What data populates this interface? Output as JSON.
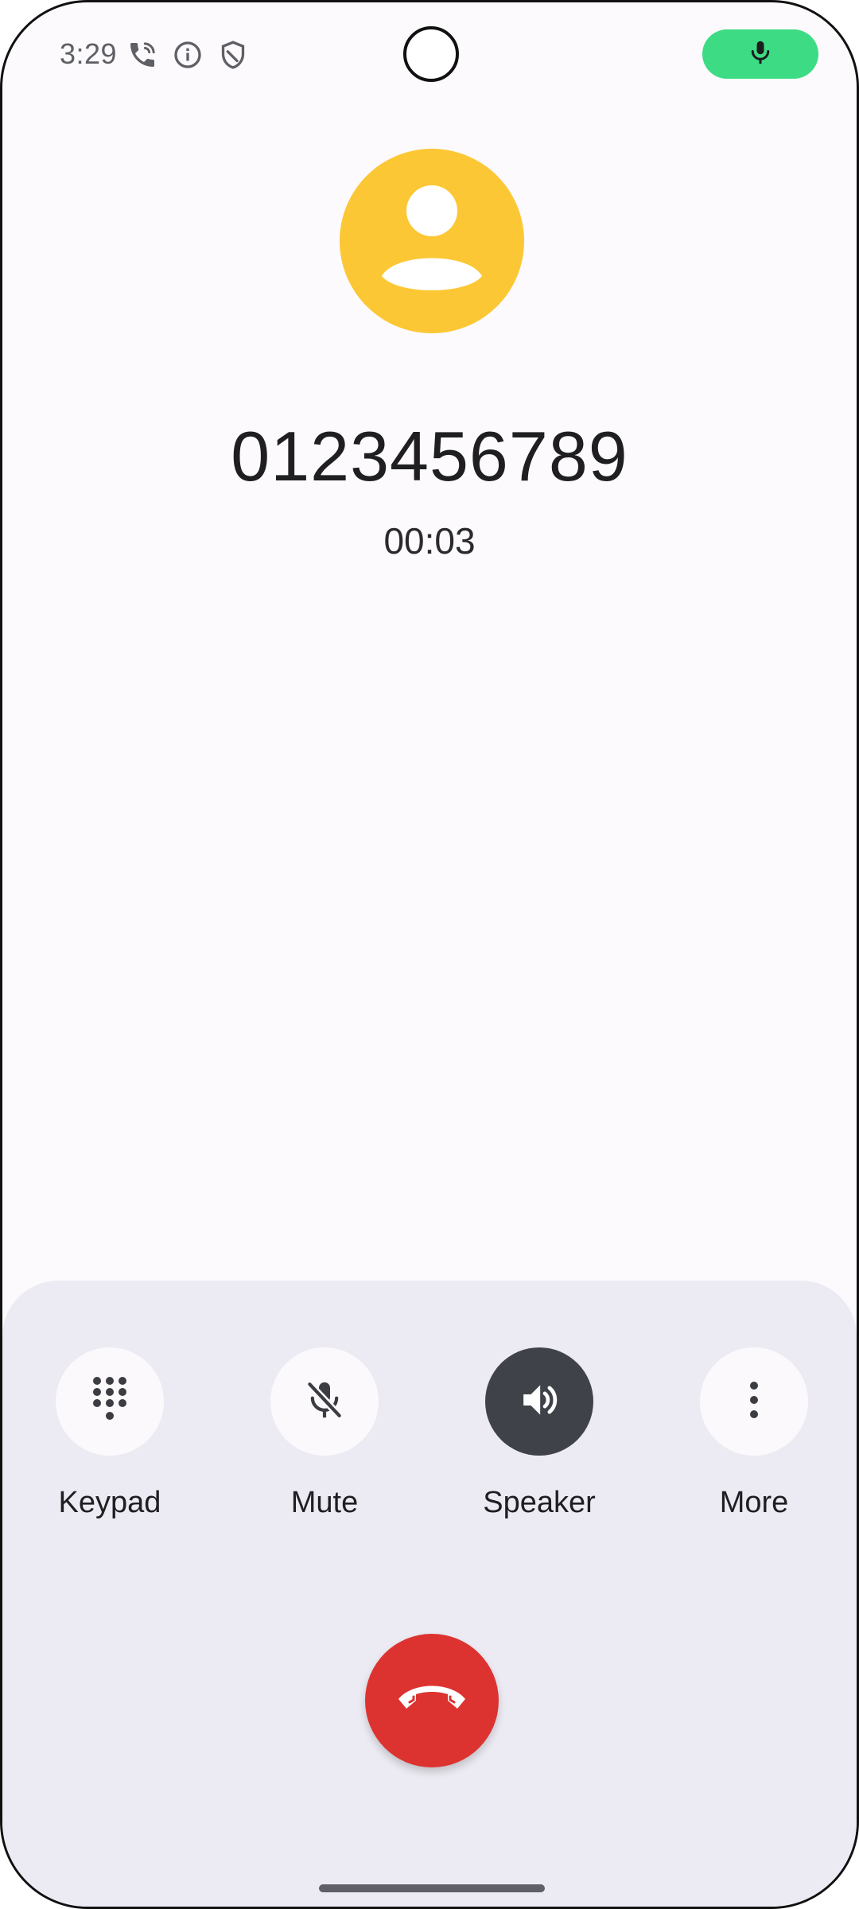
{
  "status_bar": {
    "time": "3:29",
    "icons": [
      "phone-call-icon",
      "info-icon",
      "shield-icon"
    ],
    "mic_indicator": "microphone-icon",
    "mic_indicator_color": "#3ddc84"
  },
  "call": {
    "avatar_color": "#fcc734",
    "avatar_icon": "person-icon",
    "number": "0123456789",
    "duration": "00:03"
  },
  "controls": [
    {
      "id": "keypad",
      "label": "Keypad",
      "icon": "dialpad-icon",
      "active": false
    },
    {
      "id": "mute",
      "label": "Mute",
      "icon": "mic-off-icon",
      "active": false
    },
    {
      "id": "speaker",
      "label": "Speaker",
      "icon": "speaker-icon",
      "active": true
    },
    {
      "id": "more",
      "label": "More",
      "icon": "more-vert-icon",
      "active": false
    }
  ],
  "end_call": {
    "icon": "call-end-icon",
    "color": "#dd3330"
  }
}
